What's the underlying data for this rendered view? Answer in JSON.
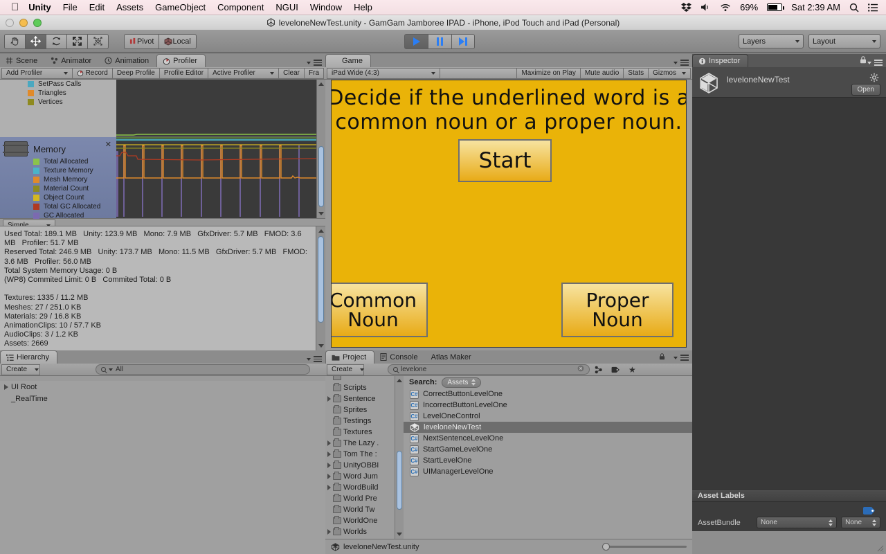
{
  "menubar": {
    "apple": "apple-logo",
    "items": [
      {
        "label": "Unity",
        "bold": true
      },
      {
        "label": "File",
        "bold": false
      },
      {
        "label": "Edit",
        "bold": false
      },
      {
        "label": "Assets",
        "bold": false
      },
      {
        "label": "GameObject",
        "bold": false
      },
      {
        "label": "Component",
        "bold": false
      },
      {
        "label": "NGUI",
        "bold": false
      },
      {
        "label": "Window",
        "bold": false
      },
      {
        "label": "Help",
        "bold": false
      }
    ],
    "status": {
      "battery_percent": "69%",
      "clock": "Sat 2:39 AM",
      "icons": [
        "dropbox-icon",
        "volume-icon",
        "wifi-icon",
        "battery-icon",
        "spotlight-search-icon",
        "notification-center-icon"
      ]
    }
  },
  "window": {
    "title": "leveloneNewTest.unity - GamGam Jamboree IPAD - iPhone, iPod Touch and iPad (Personal)"
  },
  "toolbar": {
    "transform_tools": [
      {
        "name": "hand-tool",
        "active": false
      },
      {
        "name": "move-tool",
        "active": true
      },
      {
        "name": "rotate-tool",
        "active": false
      },
      {
        "name": "scale-tool",
        "active": false
      },
      {
        "name": "rect-tool",
        "active": false
      }
    ],
    "pivot_label": "Pivot",
    "local_label": "Local",
    "play_label": "play-button",
    "pause_label": "pause-button",
    "step_label": "step-button",
    "layers_label": "Layers",
    "layout_label": "Layout"
  },
  "profiler": {
    "tabs": [
      {
        "label": "Scene",
        "icon": "grid-icon",
        "active": false
      },
      {
        "label": "Animator",
        "icon": "animator-icon",
        "active": false
      },
      {
        "label": "Animation",
        "icon": "clock-icon",
        "active": false
      },
      {
        "label": "Profiler",
        "icon": "profiler-icon",
        "active": true
      }
    ],
    "toolbar": {
      "add_profiler": "Add Profiler",
      "record": "Record",
      "deep_profile": "Deep Profile",
      "profile_editor": "Profile Editor",
      "active_profiler": "Active Profiler",
      "clear": "Clear",
      "frame": "Fra"
    },
    "render_legend": [
      {
        "label": "SetPass Calls",
        "color": "#4aa8c0"
      },
      {
        "label": "Triangles",
        "color": "#e08a2a"
      },
      {
        "label": "Vertices",
        "color": "#8e8a1f"
      }
    ],
    "memory_module": {
      "title": "Memory",
      "icon": "memory-chip-icon",
      "close": "✕",
      "legend": [
        {
          "label": "Total Allocated",
          "color": "#8bc34a"
        },
        {
          "label": "Texture Memory",
          "color": "#4ab4c8"
        },
        {
          "label": "Mesh Memory",
          "color": "#e08a2a"
        },
        {
          "label": "Material Count",
          "color": "#8e8a1f"
        },
        {
          "label": "Object Count",
          "color": "#d4b820"
        },
        {
          "label": "Total GC Allocated",
          "color": "#b03a22"
        },
        {
          "label": "GC Allocated",
          "color": "#7b6ab0"
        }
      ]
    },
    "mode": "Simple",
    "stats": "Used Total: 189.1 MB   Unity: 123.9 MB   Mono: 7.9 MB   GfxDriver: 5.7 MB   FMOD: 3.6 MB   Profiler: 51.7 MB\nReserved Total: 246.9 MB   Unity: 173.7 MB   Mono: 11.5 MB   GfxDriver: 5.7 MB   FMOD: 3.6 MB   Profiler: 56.0 MB\nTotal System Memory Usage: 0 B\n(WP8) Commited Limit: 0 B   Commited Total: 0 B\n\nTextures: 1335 / 11.2 MB\nMeshes: 27 / 251.0 KB\nMaterials: 29 / 16.8 KB\nAnimationClips: 10 / 57.7 KB\nAudioClips: 3 / 1.2 KB\nAssets: 2669"
  },
  "game": {
    "tab_label": "Game",
    "aspect": "iPad Wide (4:3)",
    "maximize_on_play": "Maximize on Play",
    "mute_audio": "Mute audio",
    "stats": "Stats",
    "gizmos": "Gizmos",
    "background_color": "#eab308",
    "prompt": "Decide if the underlined word is a\ncommon noun or a proper noun.",
    "start_button": "Start",
    "common_button": "Common\nNoun",
    "proper_button": "Proper\nNoun"
  },
  "inspector": {
    "tab_label": "Inspector",
    "asset_name": "leveloneNewTest",
    "open_button": "Open",
    "asset_labels_title": "Asset Labels",
    "assetbundle_label": "AssetBundle",
    "assetbundle_value": "None",
    "assetbundle_variant": "None"
  },
  "hierarchy": {
    "tab_label": "Hierarchy",
    "create_label": "Create",
    "search_placeholder": "All",
    "items": [
      {
        "label": "UI Root",
        "expandable": true
      },
      {
        "label": "_RealTime",
        "expandable": false
      }
    ]
  },
  "project": {
    "tabs": [
      {
        "label": "Project",
        "active": true
      },
      {
        "label": "Console",
        "active": false
      },
      {
        "label": "Atlas Maker",
        "active": false
      }
    ],
    "create_label": "Create",
    "search_value": "levelone",
    "search_scope_label": "Search:",
    "search_scope": "Assets",
    "folders": [
      {
        "label": "Scripts",
        "expandable": false
      },
      {
        "label": "Sentence",
        "expandable": true
      },
      {
        "label": "Sprites",
        "expandable": false
      },
      {
        "label": "Testings",
        "expandable": false
      },
      {
        "label": "Textures",
        "expandable": false
      },
      {
        "label": "The Lazy .",
        "expandable": true
      },
      {
        "label": "Tom The :",
        "expandable": true
      },
      {
        "label": "UnityOBBI",
        "expandable": true
      },
      {
        "label": "Word Jum",
        "expandable": true
      },
      {
        "label": "WordBuild",
        "expandable": true
      },
      {
        "label": "World Pre",
        "expandable": false
      },
      {
        "label": "World Tw",
        "expandable": false
      },
      {
        "label": "WorldOne",
        "expandable": false
      },
      {
        "label": "Worlds",
        "expandable": true
      }
    ],
    "assets": [
      {
        "label": "CorrectButtonLevelOne",
        "type": "csharp",
        "selected": false
      },
      {
        "label": "IncorrectButtonLevelOne",
        "type": "csharp",
        "selected": false
      },
      {
        "label": "LevelOneControl",
        "type": "csharp",
        "selected": false
      },
      {
        "label": "leveloneNewTest",
        "type": "scene",
        "selected": true
      },
      {
        "label": "NextSentenceLevelOne",
        "type": "csharp",
        "selected": false
      },
      {
        "label": "StartGameLevelOne",
        "type": "csharp",
        "selected": false
      },
      {
        "label": "StartLevelOne",
        "type": "csharp",
        "selected": false
      },
      {
        "label": "UIManagerLevelOne",
        "type": "csharp",
        "selected": false
      }
    ],
    "status_file": "leveloneNewTest.unity"
  }
}
